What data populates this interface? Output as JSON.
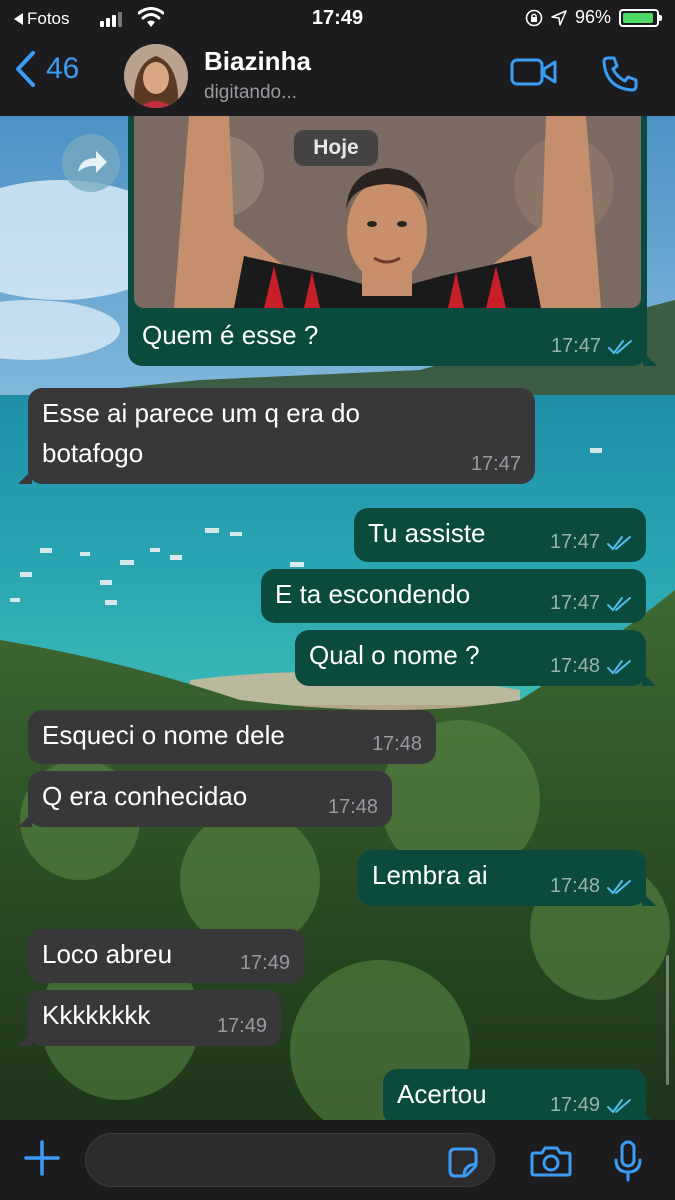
{
  "status_bar": {
    "back_app": "Fotos",
    "time": "17:49",
    "battery": "96%",
    "battery_level": 0.96
  },
  "header": {
    "back_count": "46",
    "contact_name": "Biazinha",
    "contact_status": "digitando..."
  },
  "chat": {
    "date_label": "Hoje",
    "messages": [
      {
        "dir": "out",
        "text": "Quem é esse ?",
        "time": "17:47",
        "has_image": true
      },
      {
        "dir": "in",
        "text": "Esse ai parece um q era do",
        "text2": "botafogo",
        "time": "17:47"
      },
      {
        "dir": "out",
        "text": "Tu assiste",
        "time": "17:47"
      },
      {
        "dir": "out",
        "text": "E ta escondendo",
        "time": "17:47"
      },
      {
        "dir": "out",
        "text": "Qual o nome ?",
        "time": "17:48"
      },
      {
        "dir": "in",
        "text": "Esqueci o nome dele",
        "time": "17:48"
      },
      {
        "dir": "in",
        "text": "Q era conhecidao",
        "time": "17:48"
      },
      {
        "dir": "out",
        "text": "Lembra ai",
        "time": "17:48"
      },
      {
        "dir": "in",
        "text": "Loco abreu",
        "time": "17:49"
      },
      {
        "dir": "in",
        "text": "Kkkkkkkk",
        "time": "17:49"
      },
      {
        "dir": "out",
        "text": "Acertou",
        "time": "17:49"
      }
    ]
  },
  "icons": {
    "back": "chevron-left-icon",
    "video": "video-camera-icon",
    "call": "phone-icon",
    "forward": "forward-arrow-icon",
    "add": "plus-icon",
    "sticker": "sticker-icon",
    "camera": "camera-icon",
    "mic": "microphone-icon",
    "read": "double-check-icon"
  },
  "colors": {
    "accent": "#3b9cf5",
    "outgoing_bubble": "#0b4b3e",
    "incoming_bubble": "#38383a",
    "read_ticks": "#53bdeb"
  }
}
